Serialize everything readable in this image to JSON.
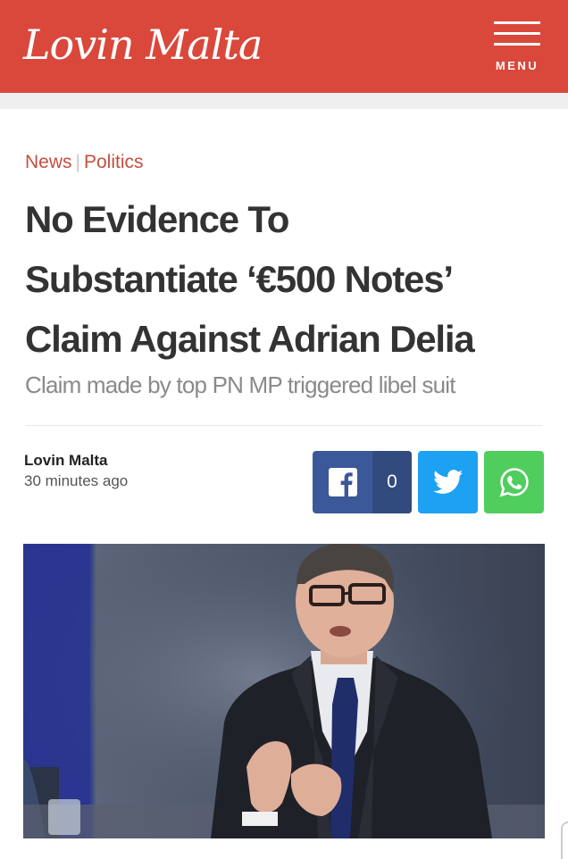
{
  "header": {
    "logo_text": "Lovin Malta",
    "menu_label": "MENU",
    "brand_color": "#d9483b"
  },
  "article": {
    "breadcrumb": [
      "News",
      "Politics"
    ],
    "breadcrumb_separator": "|",
    "title_lines": [
      "No Evidence To",
      "Substantiate ‘€500 Notes’",
      "Claim Against Adrian Delia"
    ],
    "subtitle": "Claim made by top PN MP triggered libel suit",
    "author": "Lovin Malta",
    "time": "30 minutes ago"
  },
  "share": {
    "facebook_count": "0",
    "facebook_color": "#3b5998",
    "twitter_color": "#1da1f2",
    "whatsapp_color": "#4fce5d",
    "icons": [
      "facebook-icon",
      "twitter-icon",
      "whatsapp-icon"
    ]
  },
  "photo": {
    "description_icon": "article-photo"
  }
}
